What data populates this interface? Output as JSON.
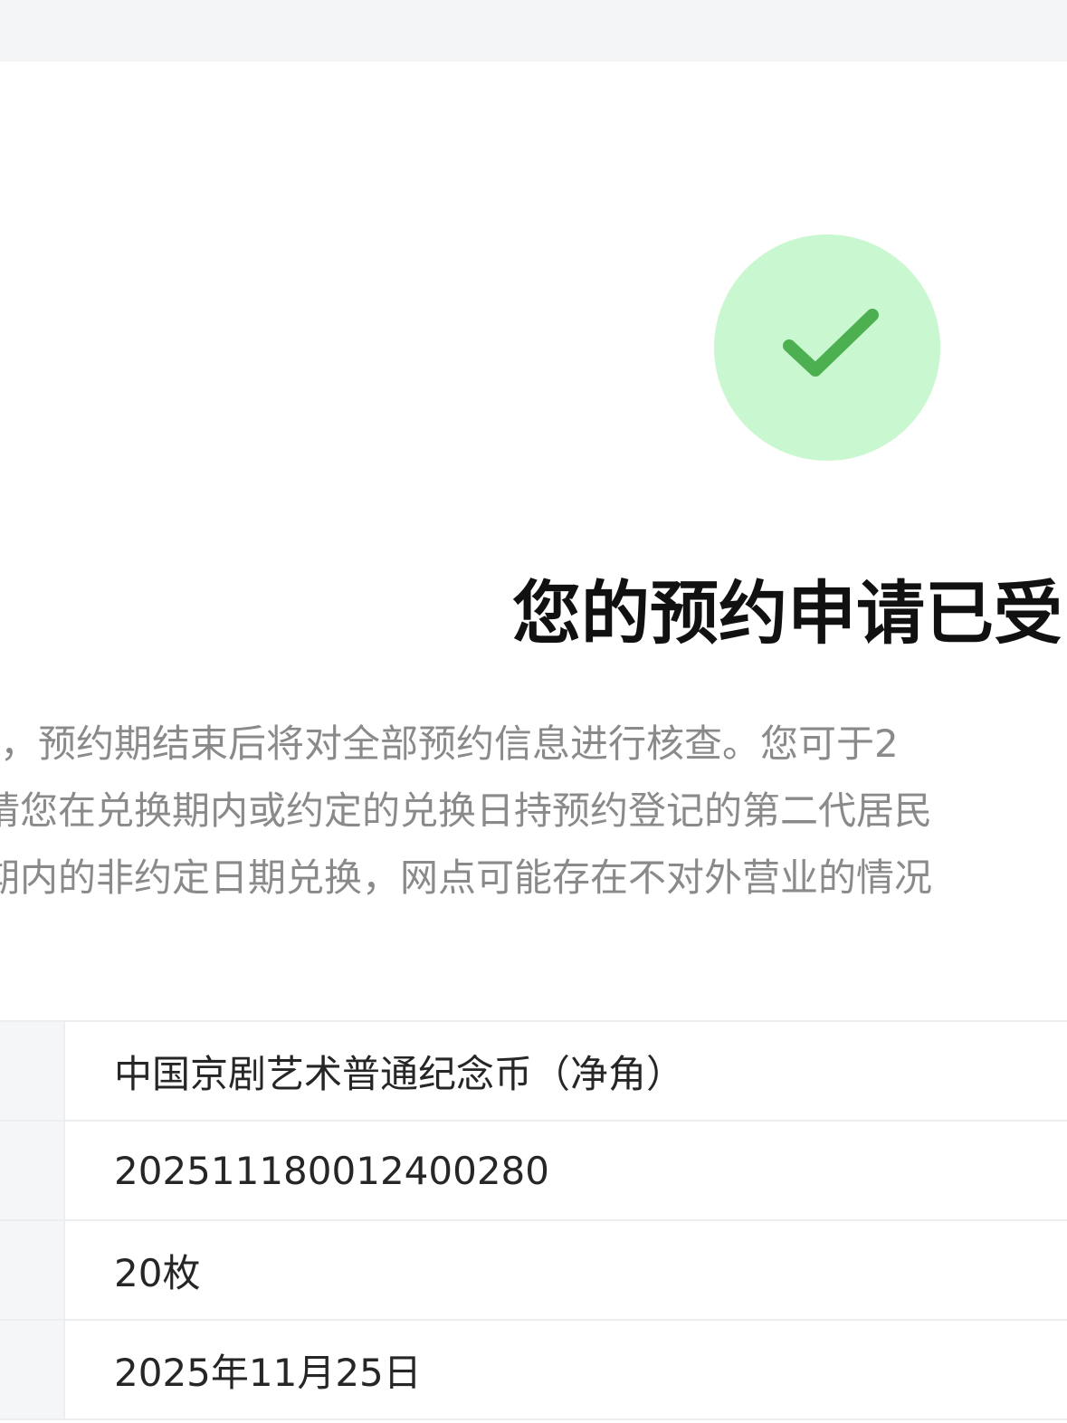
{
  "result": {
    "title": "您的预约申请已受",
    "icon": "check-circle-icon",
    "icon_bg_color": "#c9f7cf",
    "icon_check_color": "#4caf50"
  },
  "notice": {
    "lines": [
      "，预约期结束后将对全部预约信息进行核查。您可于2",
      "请您在兑换期内或约定的兑换日持预约登记的第二代居民",
      "期内的非约定日期兑换，网点可能存在不对外营业的情况"
    ]
  },
  "details": {
    "rows": [
      {
        "value": "中国京剧艺术普通纪念币（净角）"
      },
      {
        "value": "2025111800124002​80"
      },
      {
        "value": "20枚"
      },
      {
        "value": "2025年11月25日"
      }
    ]
  }
}
